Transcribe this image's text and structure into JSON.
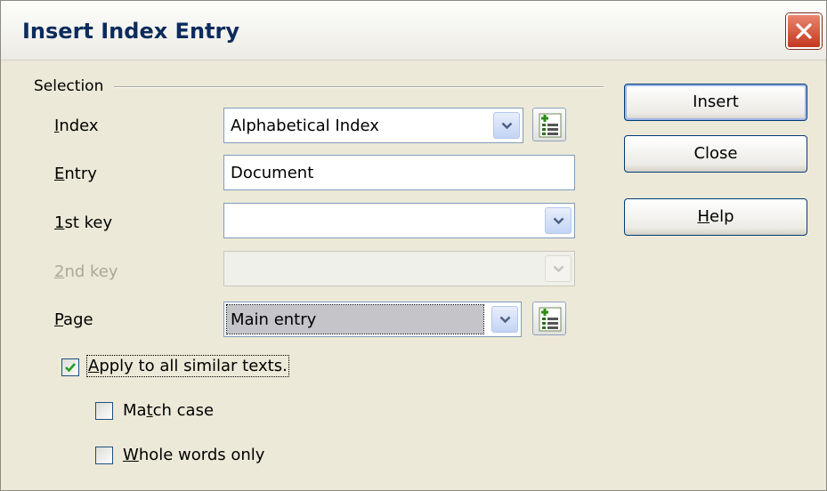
{
  "window": {
    "title": "Insert Index Entry"
  },
  "selection": {
    "group_label": "Selection",
    "index": {
      "label_accel": "I",
      "label_rest": "ndex",
      "value": "Alphabetical Index"
    },
    "entry": {
      "label_accel": "E",
      "label_rest": "ntry",
      "value": "Document"
    },
    "key1": {
      "label_accel": "1",
      "label_rest": "st key",
      "value": ""
    },
    "key2": {
      "label_accel": "2",
      "label_rest": "nd key",
      "value": ""
    },
    "page": {
      "label_accel": "P",
      "label_rest": "age",
      "value": "Main entry"
    }
  },
  "options": {
    "apply_all": {
      "label_accel": "A",
      "label_rest": "pply to all similar texts.",
      "checked": true
    },
    "match_case": {
      "label_pre": "Ma",
      "label_accel": "t",
      "label_rest": "ch case",
      "checked": false
    },
    "whole_words": {
      "label_accel": "W",
      "label_rest": "hole words only",
      "checked": false
    }
  },
  "buttons": {
    "insert": "Insert",
    "close": "Close",
    "help_accel": "H",
    "help_rest": "elp"
  },
  "icons": {
    "close": "close-x-icon",
    "new_index": "new-user-index-icon",
    "dropdown": "chevron-down-icon",
    "check": "checkmark-icon"
  }
}
